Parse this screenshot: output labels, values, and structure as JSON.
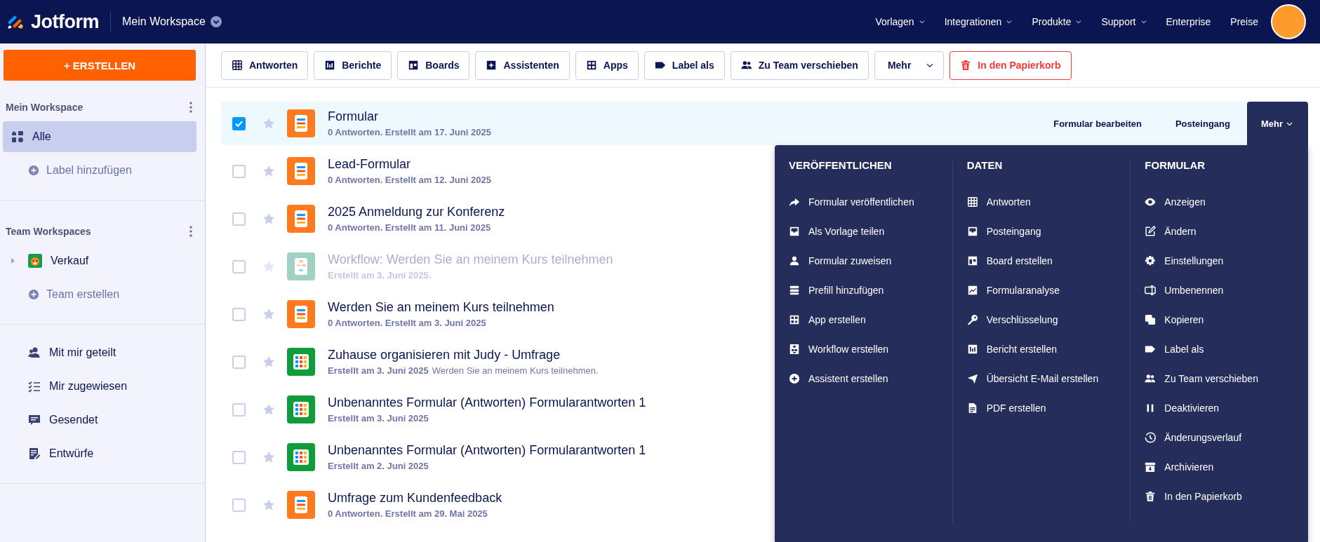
{
  "topbar": {
    "brand": "Jotform",
    "workspace": "Mein Workspace",
    "links": [
      {
        "label": "Vorlagen",
        "dropdown": true
      },
      {
        "label": "Integrationen",
        "dropdown": true
      },
      {
        "label": "Produkte",
        "dropdown": true
      },
      {
        "label": "Support",
        "dropdown": true
      },
      {
        "label": "Enterprise",
        "dropdown": false
      },
      {
        "label": "Preise",
        "dropdown": false
      }
    ]
  },
  "sidebar": {
    "create_button": "+ ERSTELLEN",
    "sections": [
      {
        "title": "Mein Workspace",
        "items": [
          {
            "kind": "nav",
            "label": "Alle",
            "selected": true
          },
          {
            "kind": "add",
            "label": "Label hinzufügen",
            "selected": false
          }
        ]
      },
      {
        "title": "Team Workspaces",
        "items": [
          {
            "kind": "team",
            "label": "Verkauf",
            "expanded": false,
            "selected": false
          },
          {
            "kind": "add",
            "label": "Team erstellen",
            "selected": false
          }
        ]
      },
      {
        "items": [
          {
            "kind": "nav",
            "label": "Mit mir geteilt",
            "selected": false
          },
          {
            "kind": "nav",
            "label": "Mir zugewiesen",
            "selected": false
          },
          {
            "kind": "nav",
            "label": "Gesendet",
            "selected": false
          },
          {
            "kind": "nav",
            "label": "Entwürfe",
            "selected": false
          }
        ]
      }
    ]
  },
  "toolbar": [
    {
      "label": "Antworten",
      "kind": "normal"
    },
    {
      "label": "Berichte",
      "kind": "normal"
    },
    {
      "label": "Boards",
      "kind": "normal"
    },
    {
      "label": "Assistenten",
      "kind": "normal"
    },
    {
      "label": "Apps",
      "kind": "normal"
    },
    {
      "label": "Label als",
      "kind": "normal"
    },
    {
      "label": "Zu Team verschieben",
      "kind": "normal"
    },
    {
      "label": "Mehr",
      "kind": "dropdown"
    },
    {
      "label": "In den Papierkorb",
      "kind": "danger"
    }
  ],
  "forms": [
    {
      "title": "Formular",
      "meta": "0 Antworten. Erstellt am 17. Juni 2025",
      "kind": "form",
      "checked": true,
      "starred": false,
      "disabled": false,
      "actions": [
        "Formular bearbeiten",
        "Posteingang"
      ],
      "more": {
        "label": "Mehr",
        "expanded": true,
        "menu": [
          {
            "title": "VERÖFFENTLICHEN",
            "items": [
              "Formular veröffentlichen",
              "Als Vorlage teilen",
              "Formular zuweisen",
              "Prefill hinzufügen",
              "App erstellen",
              "Workflow erstellen",
              "Assistent erstellen"
            ]
          },
          {
            "title": "DATEN",
            "items": [
              "Antworten",
              "Posteingang",
              "Board erstellen",
              "Formularanalyse",
              "Verschlüsselung",
              "Bericht erstellen",
              "Übersicht E-Mail erstellen",
              "PDF erstellen"
            ]
          },
          {
            "title": "FORMULAR",
            "items": [
              "Anzeigen",
              "Ändern",
              "Einstellungen",
              "Umbenennen",
              "Kopieren",
              "Label als",
              "Zu Team verschieben",
              "Deaktivieren",
              "Änderungsverlauf",
              "Archivieren",
              "In den Papierkorb"
            ]
          }
        ]
      }
    },
    {
      "title": "Lead-Formular",
      "meta": "0 Antworten. Erstellt am 12. Juni 2025",
      "kind": "form",
      "checked": false,
      "starred": false,
      "disabled": false
    },
    {
      "title": "2025 Anmeldung zur Konferenz",
      "meta": "0 Antworten. Erstellt am 11. Juni 2025",
      "kind": "form",
      "checked": false,
      "starred": false,
      "disabled": false
    },
    {
      "title": "Workflow: Werden Sie an meinem Kurs teilnehmen",
      "meta": "Erstellt am 3. Juni 2025.",
      "kind": "workflow",
      "checked": false,
      "starred": false,
      "disabled": true
    },
    {
      "title": "Werden Sie an meinem Kurs teilnehmen",
      "meta": "0 Antworten. Erstellt am 3. Juni 2025",
      "kind": "form",
      "checked": false,
      "starred": false,
      "disabled": false
    },
    {
      "title": "Zuhause organisieren mit Judy - Umfrage",
      "meta": "Erstellt am 3. Juni 2025",
      "note": "Werden Sie an meinem Kurs teilnehmen.",
      "kind": "sheet",
      "checked": false,
      "starred": false,
      "disabled": false
    },
    {
      "title": "Unbenanntes Formular (Antworten) Formularantworten 1",
      "meta": "Erstellt am 3. Juni 2025",
      "kind": "sheet",
      "checked": false,
      "starred": false,
      "disabled": false
    },
    {
      "title": "Unbenanntes Formular (Antworten) Formularantworten 1",
      "meta": "Erstellt am 2. Juni 2025",
      "kind": "sheet",
      "checked": false,
      "starred": false,
      "disabled": false
    },
    {
      "title": "Umfrage zum Kundenfeedback",
      "meta": "0 Antworten. Erstellt am 29. Mai 2025",
      "kind": "form",
      "checked": false,
      "starred": false,
      "disabled": false
    }
  ]
}
